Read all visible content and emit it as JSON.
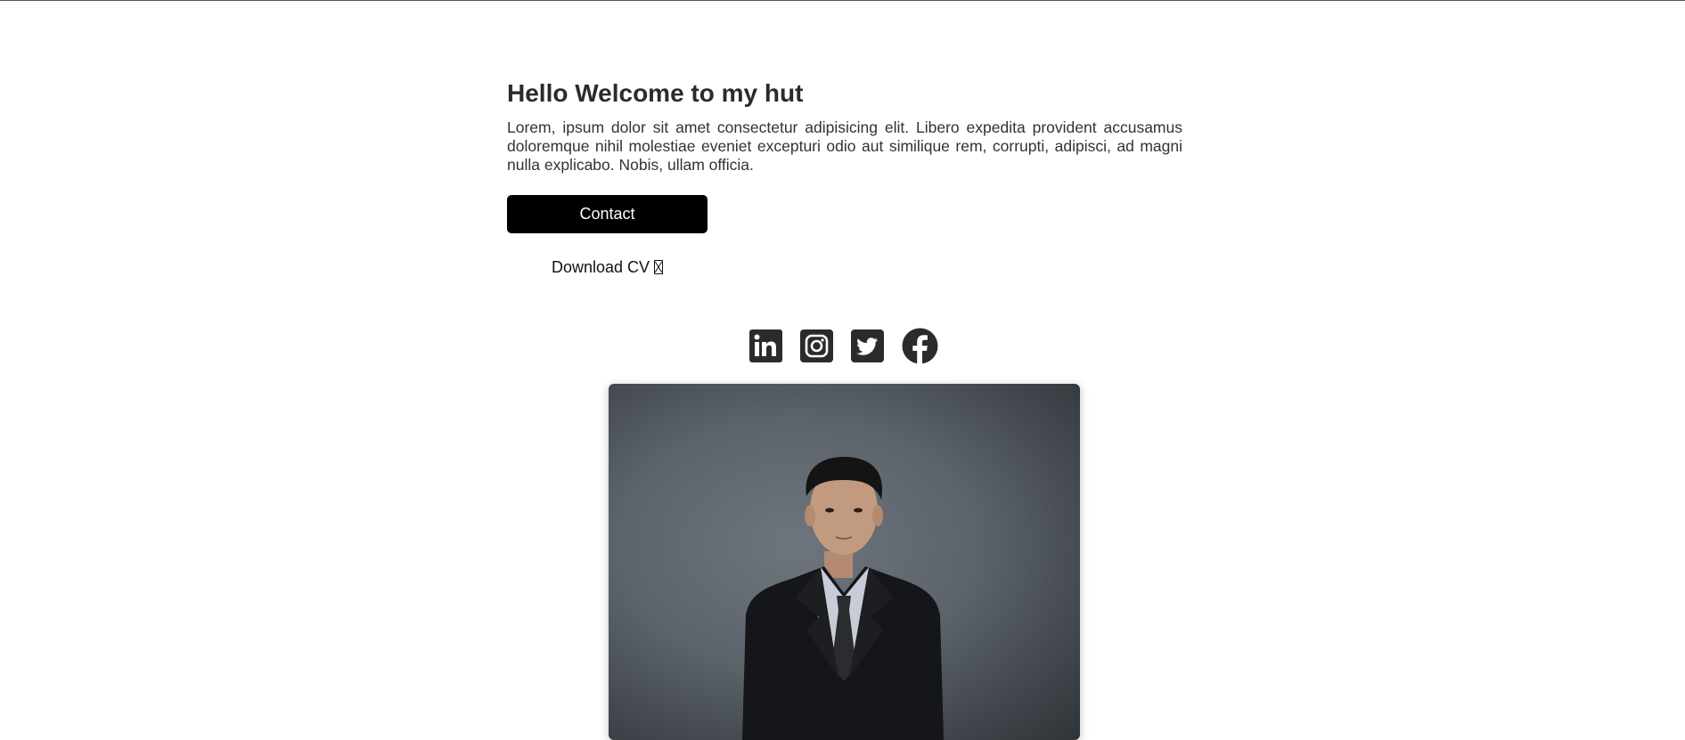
{
  "hero": {
    "title": "Hello Welcome to my hut",
    "description": "Lorem, ipsum dolor sit amet consectetur adipisicing elit. Libero expedita provident accusamus doloremque nihil molestiae eveniet excepturi odio aut similique rem, corrupti, adipisci, ad magni nulla explicabo. Nobis, ullam officia.",
    "contact_label": "Contact",
    "download_label": "Download CV"
  },
  "socials": [
    {
      "icon": "linkedin-icon"
    },
    {
      "icon": "instagram-icon"
    },
    {
      "icon": "twitter-icon"
    },
    {
      "icon": "facebook-icon"
    }
  ],
  "colors": {
    "text": "#333333",
    "button_bg": "#000000",
    "button_text": "#ffffff",
    "icon": "#2b2b2b"
  }
}
